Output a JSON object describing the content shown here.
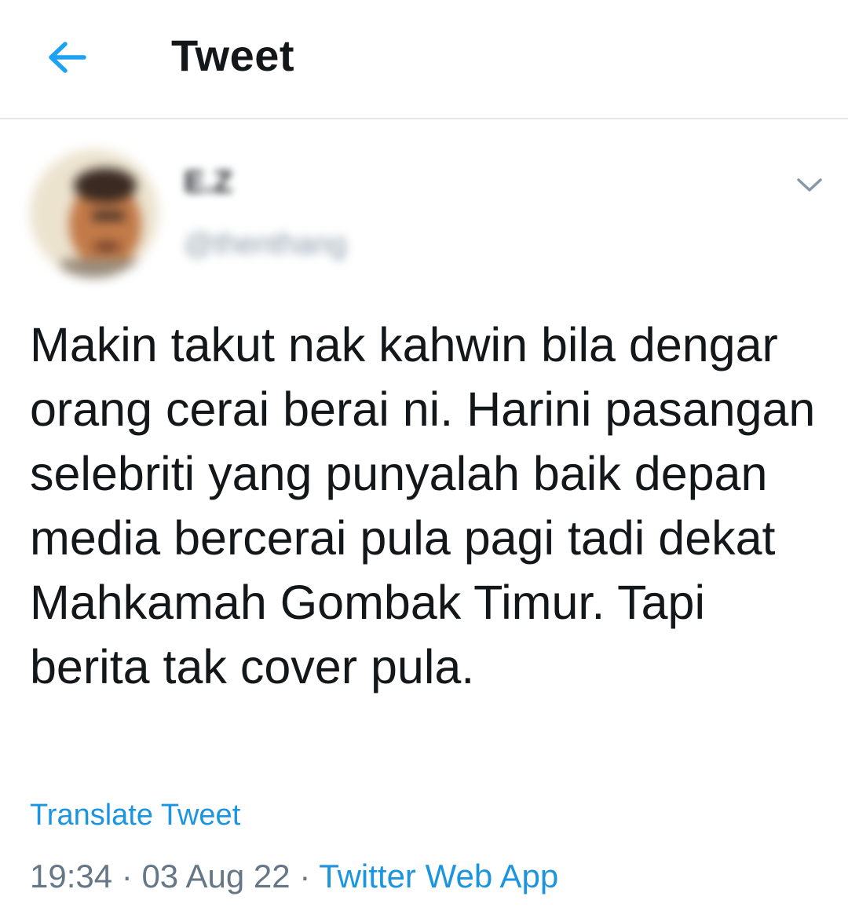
{
  "header": {
    "title": "Tweet",
    "back_icon": "arrow-left-icon",
    "accent": "#1da1f2"
  },
  "tweet": {
    "author": {
      "display_name": "E.Z",
      "handle": "@thenthang"
    },
    "menu_icon": "chevron-down-icon",
    "text": "Makin takut nak kahwin bila dengar orang cerai berai ni. Harini pasangan selebriti yang punyalah baik depan media bercerai pula pagi tadi dekat Mahkamah Gombak Timur. Tapi berita tak cover pula.",
    "translate_label": "Translate Tweet",
    "time": "19:34",
    "separator": "·",
    "date": "03 Aug 22",
    "source": "Twitter Web App",
    "link_color": "#1b95e0"
  }
}
